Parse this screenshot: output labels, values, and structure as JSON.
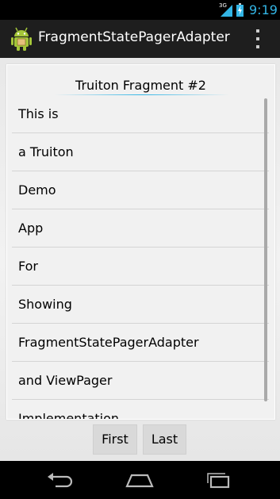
{
  "status_bar": {
    "network": "3G",
    "time": "9:19",
    "icons": [
      "signal-icon",
      "battery-icon"
    ]
  },
  "action_bar": {
    "title": "FragmentStatePagerAdapter",
    "icons": [
      "android-app-icon",
      "overflow-menu-icon"
    ]
  },
  "fragment": {
    "title": "Truiton Fragment #2",
    "items": [
      "This is",
      "a Truiton",
      "Demo",
      "App",
      "For",
      "Showing",
      "FragmentStatePagerAdapter",
      "and ViewPager",
      "Implementation"
    ]
  },
  "buttons": {
    "first": "First",
    "last": "Last"
  },
  "nav_bar": {
    "icons": [
      "back-icon",
      "home-icon",
      "recent-apps-icon"
    ]
  },
  "colors": {
    "accent": "#33b5e5",
    "action_bar": "#1e1e1e",
    "content_bg": "#eeeeee",
    "button_bg": "#d9d9d9"
  }
}
